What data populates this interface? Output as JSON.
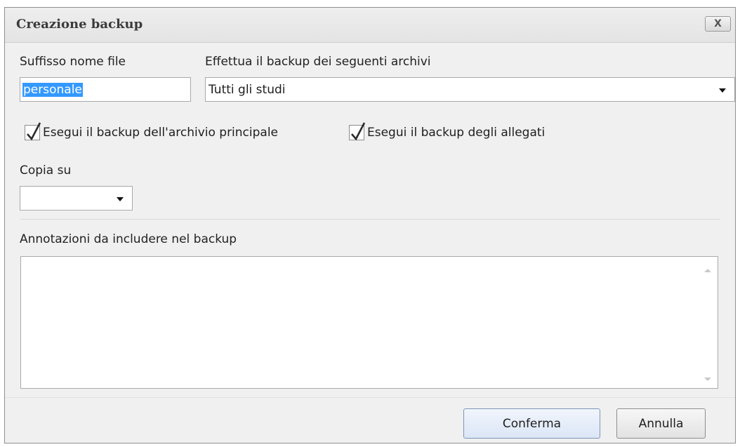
{
  "dialog": {
    "title": "Creazione backup",
    "close_label": "X"
  },
  "suffix": {
    "label": "Suffisso nome file",
    "value": "personale"
  },
  "archives": {
    "label": "Effettua il backup dei seguenti archivi",
    "selected": "Tutti gli studi"
  },
  "options": {
    "main_archive_label": "Esegui il backup dell'archivio principale",
    "main_archive_checked": true,
    "attachments_label": "Esegui il backup degli allegati",
    "attachments_checked": true
  },
  "copy_to": {
    "label": "Copia su",
    "selected": ""
  },
  "notes": {
    "label": "Annotazioni da includere nel backup",
    "value": ""
  },
  "buttons": {
    "confirm": "Conferma",
    "cancel": "Annulla"
  }
}
